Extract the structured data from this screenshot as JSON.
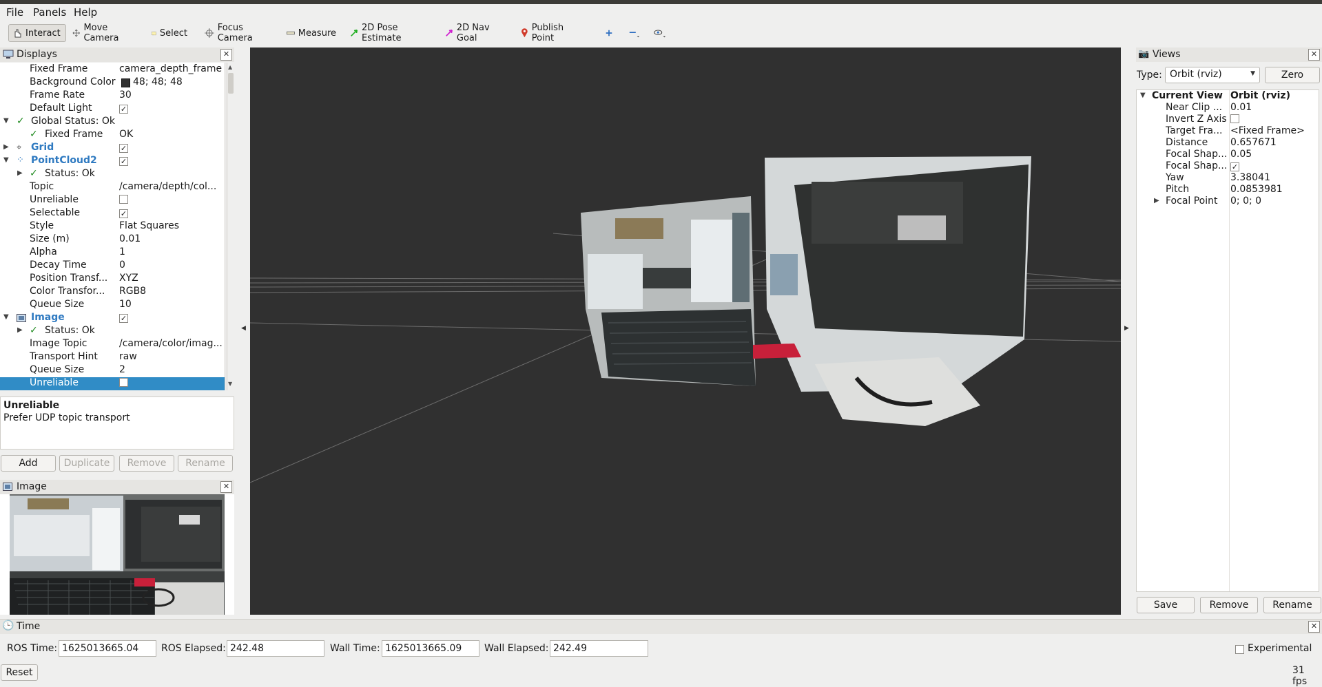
{
  "menu": {
    "file": "File",
    "panels": "Panels",
    "help": "Help"
  },
  "toolbar": {
    "interact": "Interact",
    "move_camera": "Move Camera",
    "select": "Select",
    "focus_camera": "Focus Camera",
    "measure": "Measure",
    "pose_estimate": "2D Pose Estimate",
    "nav_goal": "2D Nav Goal",
    "publish_point": "Publish Point"
  },
  "displays": {
    "title": "Displays",
    "rows": [
      {
        "k": "Fixed Frame",
        "v": "camera_depth_frame"
      },
      {
        "k": "Background Color",
        "v": "48; 48; 48"
      },
      {
        "k": "Frame Rate",
        "v": "30"
      },
      {
        "k": "Default Light",
        "v": ""
      },
      {
        "k": "Global Status: Ok",
        "v": ""
      },
      {
        "k": "Fixed Frame",
        "v": "OK"
      },
      {
        "k": "Grid",
        "v": ""
      },
      {
        "k": "PointCloud2",
        "v": ""
      },
      {
        "k": "Status: Ok",
        "v": ""
      },
      {
        "k": "Topic",
        "v": "/camera/depth/col..."
      },
      {
        "k": "Unreliable",
        "v": ""
      },
      {
        "k": "Selectable",
        "v": ""
      },
      {
        "k": "Style",
        "v": "Flat Squares"
      },
      {
        "k": "Size (m)",
        "v": "0.01"
      },
      {
        "k": "Alpha",
        "v": "1"
      },
      {
        "k": "Decay Time",
        "v": "0"
      },
      {
        "k": "Position Transf...",
        "v": "XYZ"
      },
      {
        "k": "Color Transfor...",
        "v": "RGB8"
      },
      {
        "k": "Queue Size",
        "v": "10"
      },
      {
        "k": "Image",
        "v": ""
      },
      {
        "k": "Status: Ok",
        "v": ""
      },
      {
        "k": "Image Topic",
        "v": "/camera/color/imag..."
      },
      {
        "k": "Transport Hint",
        "v": "raw"
      },
      {
        "k": "Queue Size",
        "v": "2"
      },
      {
        "k": "Unreliable",
        "v": ""
      }
    ],
    "desc_title": "Unreliable",
    "desc_text": "Prefer UDP topic transport",
    "buttons": {
      "add": "Add",
      "duplicate": "Duplicate",
      "remove": "Remove",
      "rename": "Rename"
    }
  },
  "image_panel": {
    "title": "Image"
  },
  "views": {
    "title": "Views",
    "type_label": "Type:",
    "type_value": "Orbit (rviz)",
    "zero": "Zero",
    "current_view": "Current View",
    "current_view_value": "Orbit (rviz)",
    "rows": [
      {
        "k": "Near Clip ...",
        "v": "0.01"
      },
      {
        "k": "Invert Z Axis",
        "v": ""
      },
      {
        "k": "Target Fra...",
        "v": "<Fixed Frame>"
      },
      {
        "k": "Distance",
        "v": "0.657671"
      },
      {
        "k": "Focal Shap...",
        "v": "0.05"
      },
      {
        "k": "Focal Shap...",
        "v": ""
      },
      {
        "k": "Yaw",
        "v": "3.38041"
      },
      {
        "k": "Pitch",
        "v": "0.0853981"
      },
      {
        "k": "Focal Point",
        "v": "0; 0; 0"
      }
    ],
    "buttons": {
      "save": "Save",
      "remove": "Remove",
      "rename": "Rename"
    }
  },
  "time": {
    "title": "Time",
    "ros_time_label": "ROS Time:",
    "ros_time": "1625013665.04",
    "ros_elapsed_label": "ROS Elapsed:",
    "ros_elapsed": "242.48",
    "wall_time_label": "Wall Time:",
    "wall_time": "1625013665.09",
    "wall_elapsed_label": "Wall Elapsed:",
    "wall_elapsed": "242.49",
    "experimental": "Experimental",
    "reset": "Reset",
    "fps": "31 fps"
  },
  "colors": {
    "selection": "#308cc6",
    "viewport_bg": "#303030",
    "link_blue": "#2f7ac1"
  }
}
